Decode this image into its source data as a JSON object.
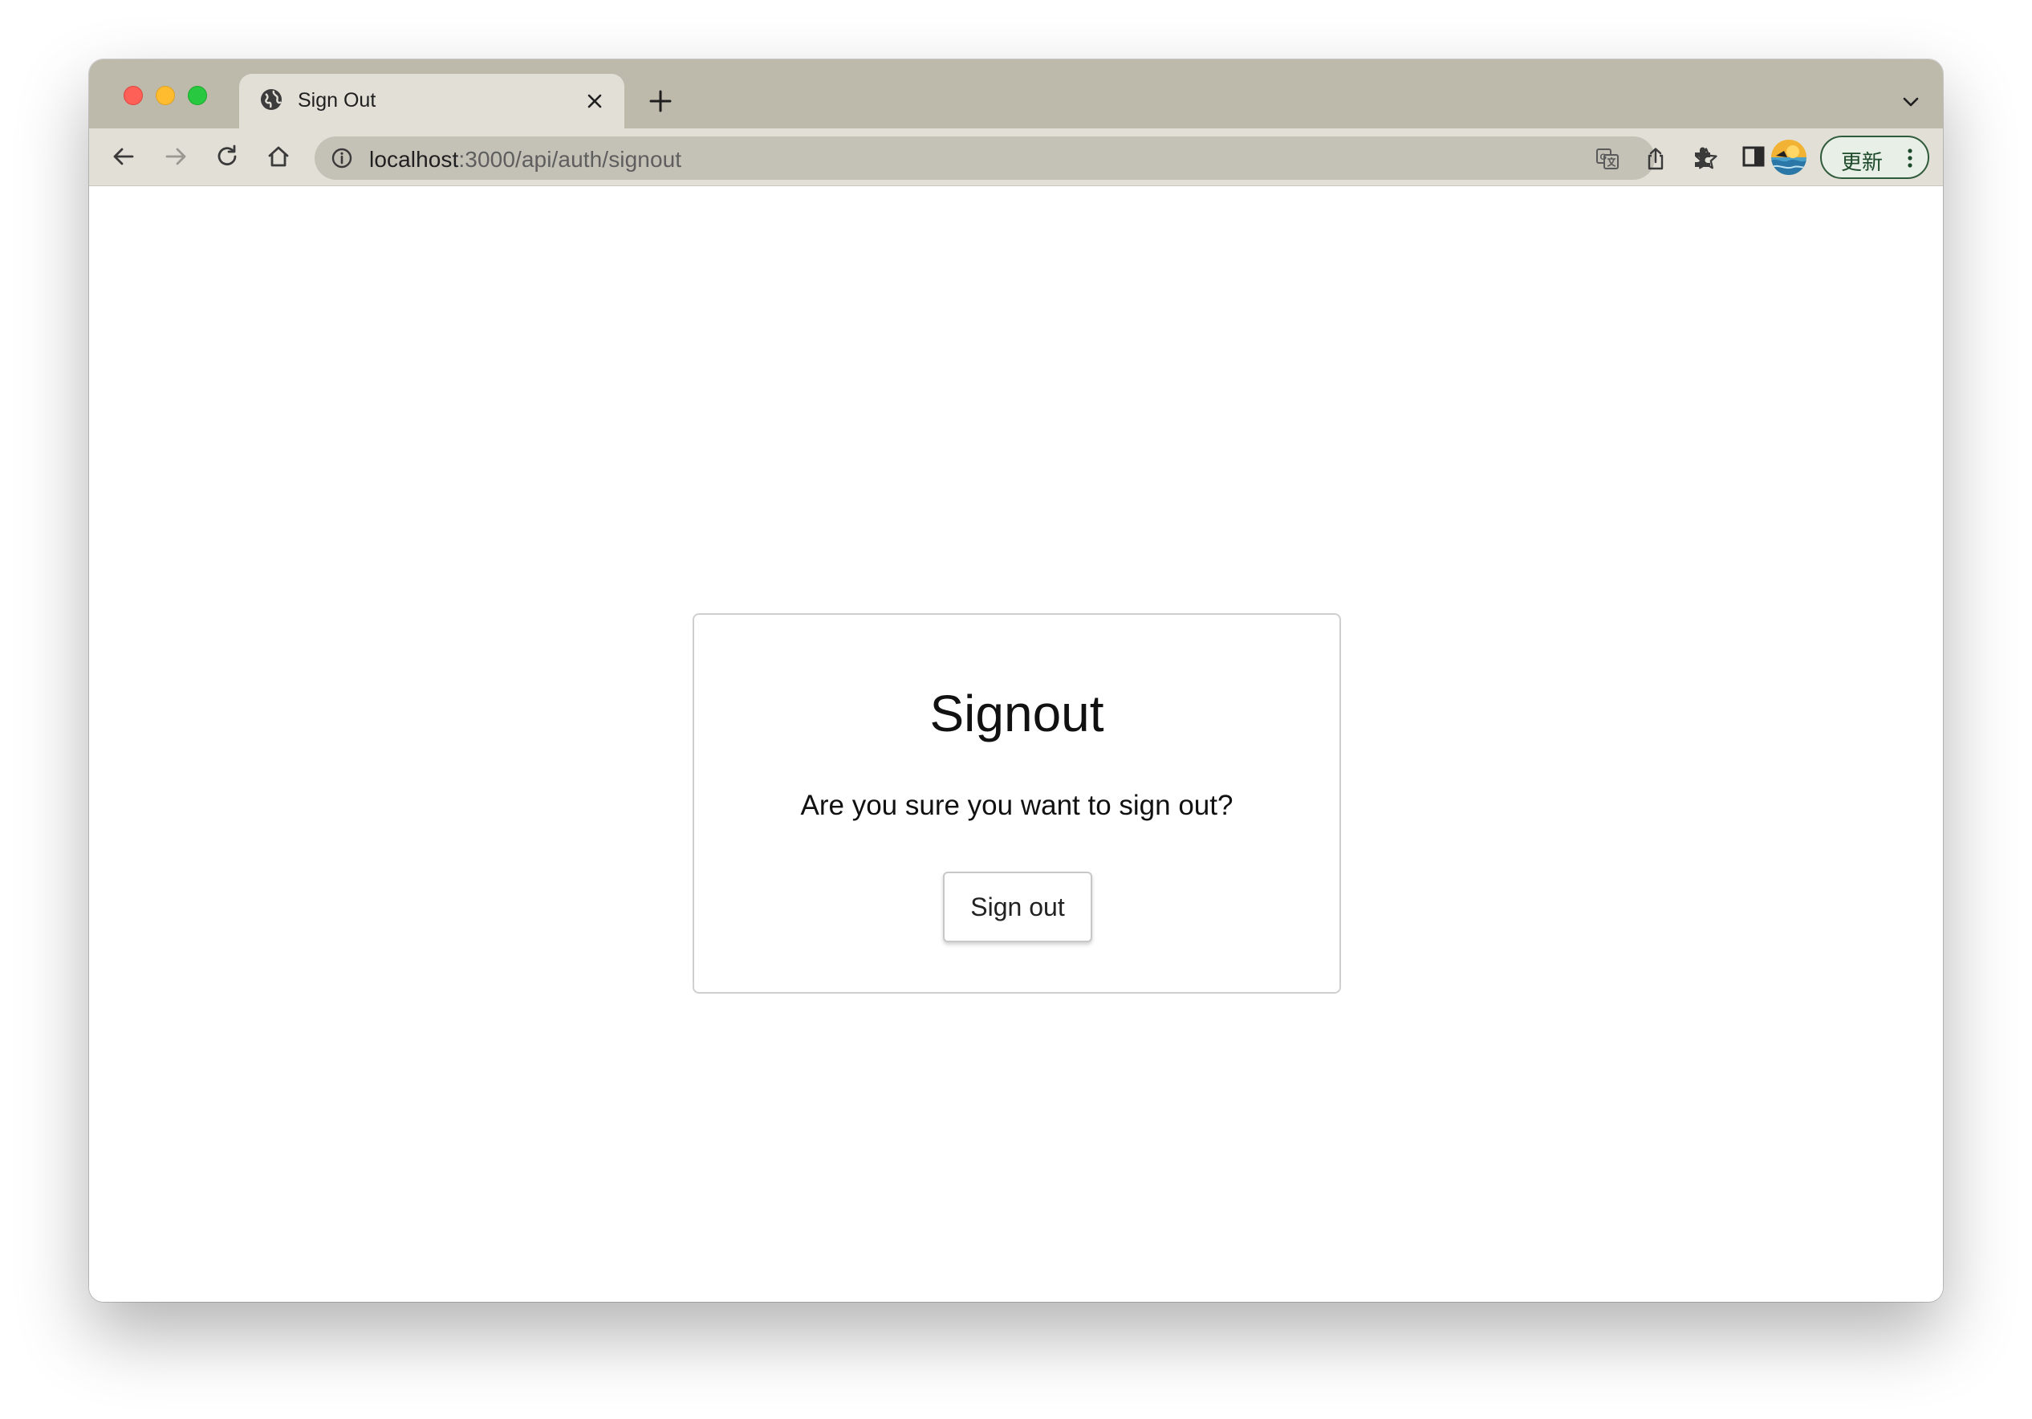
{
  "browser": {
    "tab": {
      "title": "Sign Out",
      "favicon": "globe-icon"
    },
    "address_bar": {
      "host": "localhost",
      "path": ":3000/api/auth/signout"
    },
    "update_button_label": "更新",
    "colors": {
      "tabstrip": "#bdb9ab",
      "toolbar": "#e1dfd6",
      "omnibox": "#c4c1b7",
      "update_accent": "#2f5b3b"
    }
  },
  "page": {
    "title": "Signout",
    "message": "Are you sure you want to sign out?",
    "signout_button_label": "Sign out"
  }
}
